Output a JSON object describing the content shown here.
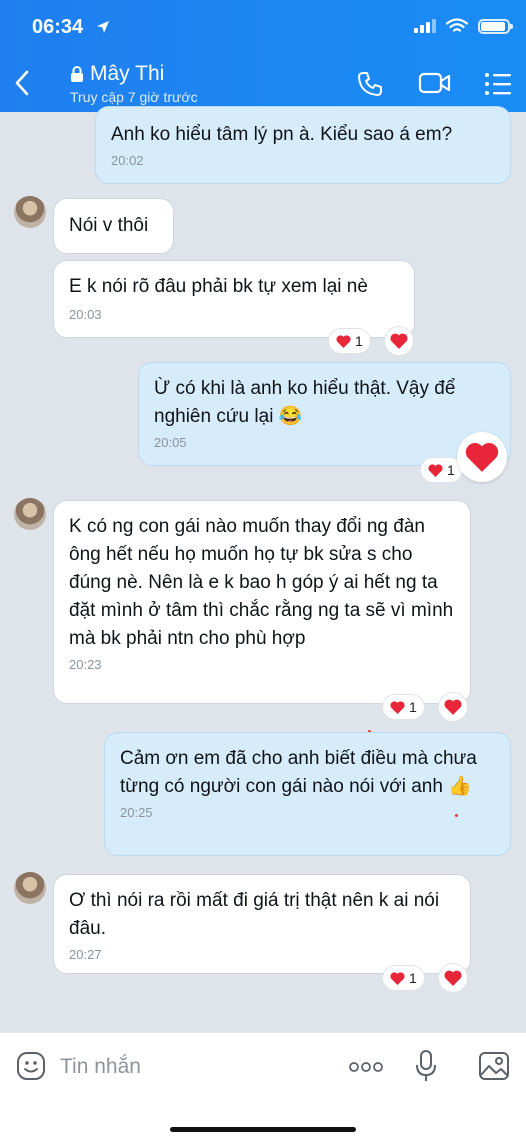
{
  "status": {
    "time": "06:34"
  },
  "header": {
    "name": "Mây Thi",
    "subtitle": "Truy cập 7 giờ trước"
  },
  "messages": [
    {
      "text": "Anh ko hiểu tâm lý pn à. Kiểu sao á em?",
      "time": "20:02"
    },
    {
      "text": "Nói v thôi"
    },
    {
      "text": "E k nói rõ đâu phải bk tự xem lại nè",
      "time": "20:03",
      "reaction_count": "1"
    },
    {
      "text": "Ừ có khi là anh ko hiểu thật. Vậy để nghiên cứu lại",
      "emoji": "😂",
      "time": "20:05",
      "reaction_count": "1"
    },
    {
      "text": "K có ng con gái nào muốn thay đổi ng đàn ông hết nếu họ muốn họ tự bk sửa s cho đúng nè. Nên là e k bao h góp ý ai hết ng ta đặt mình ở tâm thì chắc rằng ng ta sẽ vì mình mà bk phải ntn cho phù hợp",
      "time": "20:23",
      "reaction_count": "1"
    },
    {
      "text": "Cảm ơn em đã cho anh biết điều mà chưa từng có người con gái nào nói với anh",
      "emoji": "👍",
      "time": "20:25"
    },
    {
      "text": "Ơ thì nói ra rồi mất đi giá trị thật nên k ai nói đâu.",
      "time": "20:27",
      "reaction_count": "1"
    }
  ],
  "composer": {
    "placeholder": "Tin nhắn"
  },
  "colors": {
    "header": "#1f7ff0",
    "sent_bubble": "#d6ecfb",
    "received_bubble": "#ffffff",
    "heart": "#e8263a"
  }
}
